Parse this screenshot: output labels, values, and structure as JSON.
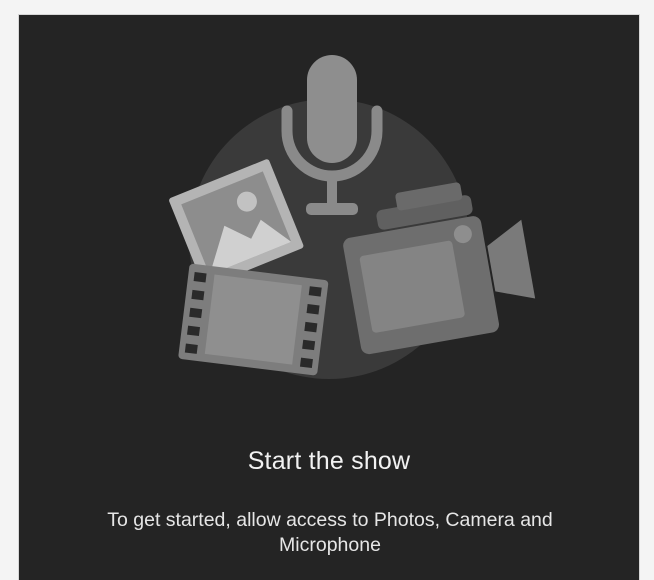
{
  "onboarding": {
    "title": "Start the show",
    "description": "To get started, allow access to Photos, Camera and Microphone"
  },
  "illustration": {
    "icons": [
      "microphone-icon",
      "photo-icon",
      "film-strip-icon",
      "video-camera-icon"
    ],
    "colors": {
      "background": "#242424",
      "circle": "#3a3a3a",
      "microphone": "#8c8c8c",
      "photo_frame": "#a8a8a8",
      "film": "#7a7a7a",
      "camera": "#6f6f6f"
    }
  }
}
